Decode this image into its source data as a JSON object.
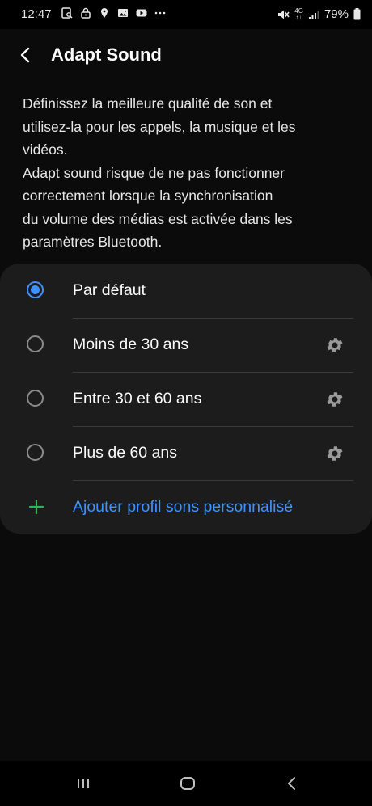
{
  "status": {
    "time": "12:47",
    "notification_icons": [
      "gallery-search-icon",
      "lock-icon",
      "location-icon",
      "image-icon",
      "youtube-icon",
      "more-icon"
    ],
    "net_type_top": "4G",
    "net_type_bottom": "↑↓",
    "battery": "79%"
  },
  "header": {
    "title": "Adapt Sound"
  },
  "description": "Définissez la meilleure qualité de son et\nutilisez-la pour les appels, la musique et les\nvidéos.\nAdapt sound risque de ne pas fonctionner\ncorrectement lorsque la synchronisation\ndu volume des médias est activée dans les\nparamètres Bluetooth.",
  "options": [
    {
      "label": "Par défaut",
      "selected": true
    },
    {
      "label": "Moins de 30 ans",
      "selected": false
    },
    {
      "label": "Entre 30 et 60 ans",
      "selected": false
    },
    {
      "label": "Plus de 60 ans",
      "selected": false
    }
  ],
  "add_profile": {
    "label": "Ajouter profil sons personnalisé"
  },
  "colors": {
    "accent": "#3e91ff",
    "plus": "#2fb553",
    "card": "#1c1c1c"
  }
}
